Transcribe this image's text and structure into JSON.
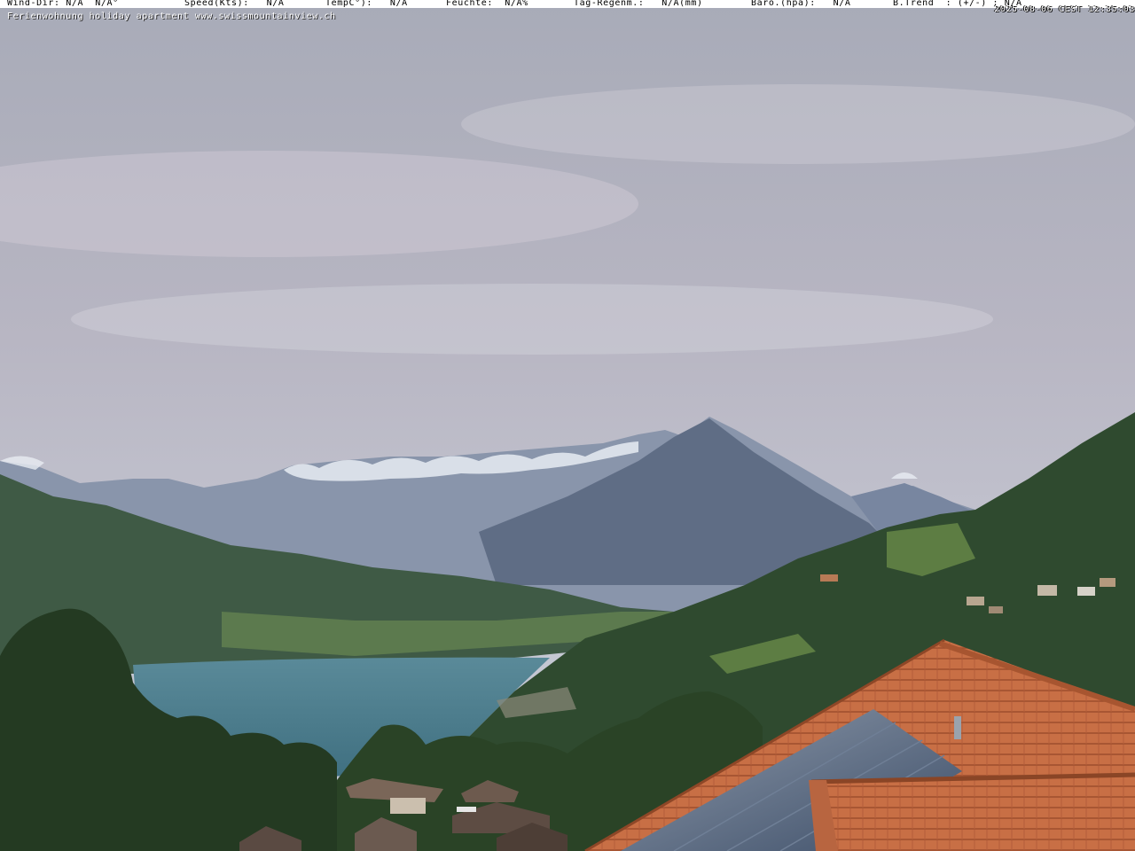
{
  "header": {
    "wind_dir": "Wind-Dir: N/A  N/A°",
    "speed": "Speed(Kts):   N/A",
    "temp": "TempC°):   N/A",
    "feuchte": "Feuchte:  N/A%",
    "regen": "Tag-Regenm.:   N/A(mm)",
    "baro": "Baro.(hpa):   N/A",
    "trend": "B.Trend  : (+/-) : N/A",
    "timestamp": "2025-08-06 CEST 12:35:03"
  },
  "subtitle": "Ferienwohnung holiday apartment www.swissmountainview.ch",
  "colors": {
    "sky_top": "#a9acb9",
    "sky_bottom": "#c4c7d2",
    "mountain_far": "#8a96aa",
    "mountain_peak": "#5d6b82",
    "lake": "#4f7f8f",
    "forest": "#2f4a2e",
    "roof": "#c9734a",
    "solar": "#4a5d78"
  }
}
